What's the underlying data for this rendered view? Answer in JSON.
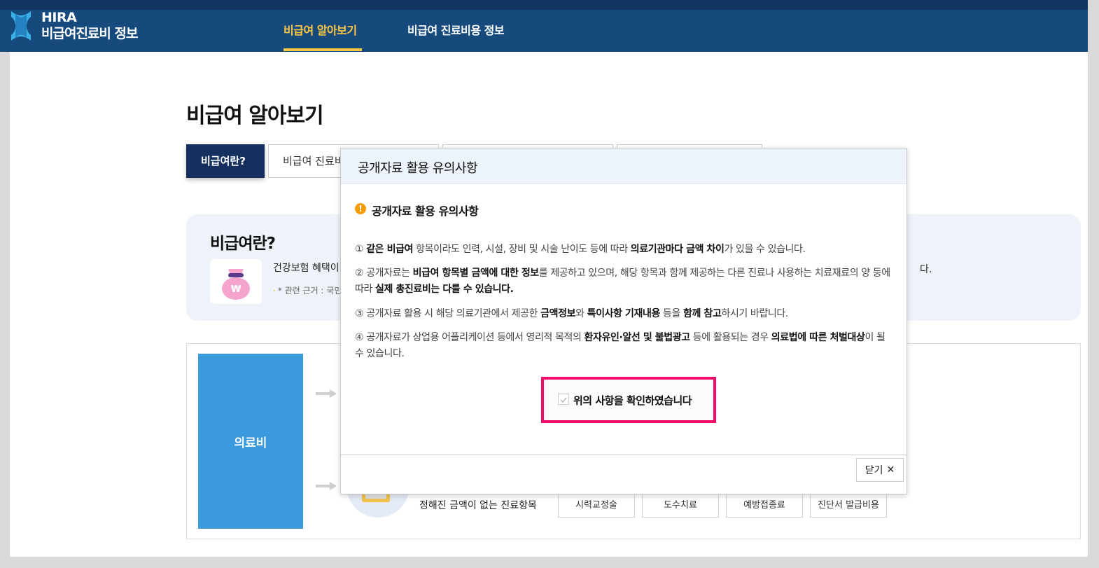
{
  "header": {
    "logo_line1": "HIRA",
    "logo_line2": "비급여진료비 정보",
    "nav": [
      "비급여 알아보기",
      "비급여 진료비용 정보"
    ]
  },
  "page": {
    "title": "비급여 알아보기",
    "tabs": [
      "비급여란?",
      "비급여 진료비"
    ]
  },
  "info": {
    "title": "비급여란?",
    "text": "건강보험 혜택이 적",
    "note": "* 관련 근거 : 국민건",
    "tail": "다."
  },
  "diagram": {
    "main_label": "의료비",
    "lower_text_1": "",
    "lower_text_2": "정해진 금액이 없는 진료항목",
    "chips": [
      "시력교정술",
      "도수치료",
      "예방접종료",
      "진단서 발급비용"
    ]
  },
  "modal": {
    "header_title": "공개자료 활용 유의사항",
    "section_title": "공개자료 활용 유의사항",
    "notices": [
      "① <b>같은 비급여</b> 항목이라도 인력, 시설, 장비 및 시술 난이도 등에 따라 <b>의료기관마다 금액 차이</b>가 있을 수 있습니다.",
      "② 공개자료는 <b>비급여 항목별 금액에 대한 정보</b>를 제공하고 있으며, 해당 항목과 함께 제공하는 다른 진료나 사용하는 치료재료의 양 등에 따라 <b>실제 총진료비는 다를 수 있습니다.</b>",
      "③ 공개자료 활용 시 해당 의료기관에서 제공한 <b>금액정보</b>와 <b>특이사항 기재내용</b> 등을 <b>함께 참고</b>하시기 바랍니다.",
      "④ 공개자료가 상업용 어플리케이션 등에서 영리적 목적의 <b>환자유인·알선 및 불법광고</b> 등에 활용되는 경우 <b>의료법에 따른 처벌대상</b>이 될 수 있습니다."
    ],
    "confirm_label": "위의 사항을 확인하였습니다",
    "close_label": "닫기",
    "close_glyph": "✕"
  },
  "colors": {
    "header_bg": "#164a7d",
    "accent": "#ffc740",
    "active_tab": "#15305e",
    "highlight": "#f20c6a",
    "med_box": "#3a9add"
  }
}
